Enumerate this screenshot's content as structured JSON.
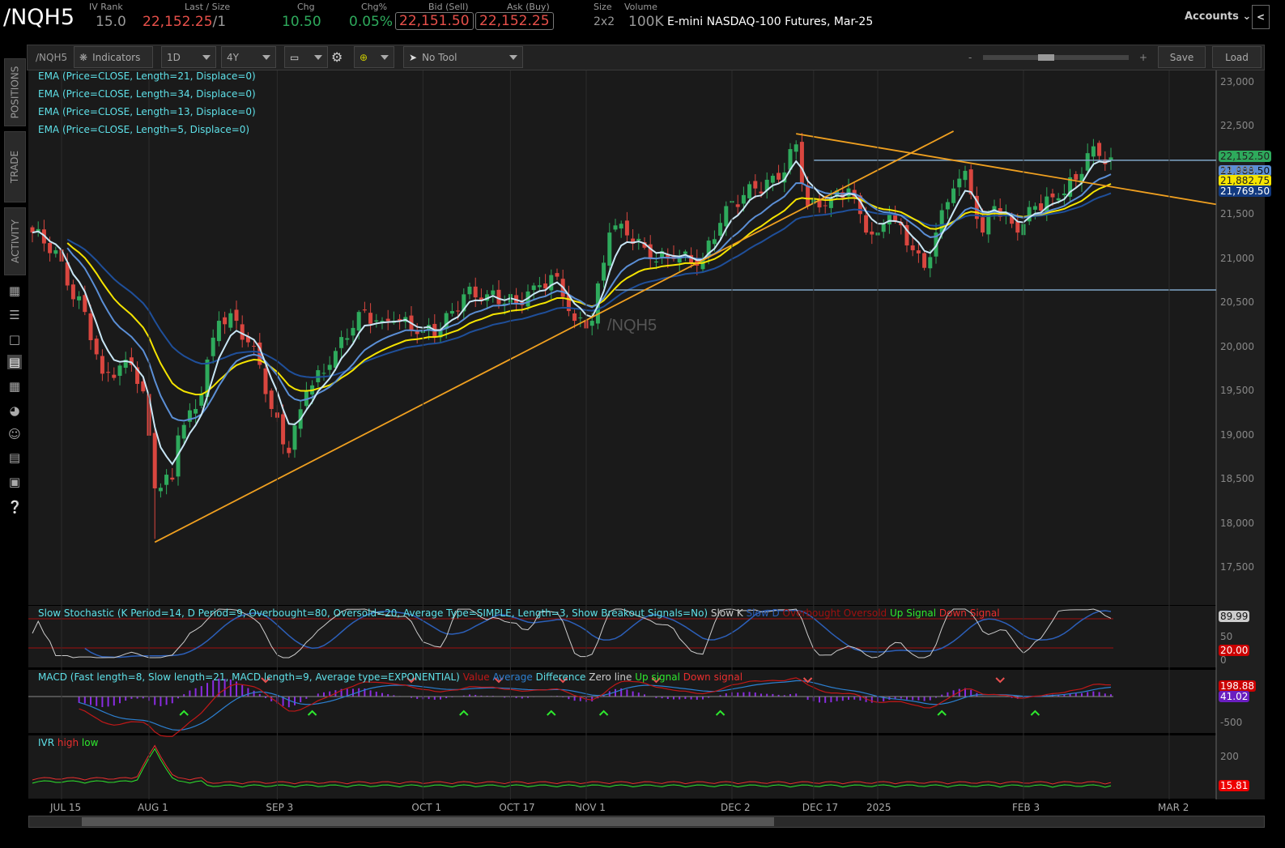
{
  "header": {
    "symbol": "/NQH5",
    "iv_rank_label": "IV Rank",
    "iv_rank": "15.0",
    "last_label": "Last / Size",
    "last": "22,152.25",
    "size_sep": "/1",
    "chg_label": "Chg",
    "chg": "10.50",
    "chgp_label": "Chg%",
    "chgp": "0.05%",
    "bid_label": "Bid (Sell)",
    "bid": "22,151.50",
    "ask_label": "Ask (Buy)",
    "ask": "22,152.25",
    "size_label": "Size",
    "size": "2x2",
    "volume_label": "Volume",
    "volume": "100K",
    "description": "E-mini NASDAQ-100 Futures, Mar-25",
    "accounts": "Accounts",
    "collapse": "<"
  },
  "toolbar": {
    "symbol": "/NQH5",
    "indicators": "Indicators",
    "aggregation": "1D",
    "range": "4Y",
    "tool": "No Tool",
    "zoom_minus": "-",
    "zoom_plus": "+",
    "save": "Save",
    "load": "Load"
  },
  "sidebar": {
    "tabs": [
      "POSITIONS",
      "TRADE",
      "ACTIVITY"
    ]
  },
  "studies": [
    "EMA (Price=CLOSE, Length=21, Displace=0)",
    "EMA (Price=CLOSE, Length=34, Displace=0)",
    "EMA (Price=CLOSE, Length=13, Displace=0)",
    "EMA (Price=CLOSE, Length=5, Displace=0)"
  ],
  "watermark": "/NQH5",
  "stoch": {
    "title": "Slow Stochastic (K Period=14, D Period=9, Overbought=80, Oversold=20, Average Type=SIMPLE, Length=3, Show Breakout Signals=No)",
    "legend": [
      "Slow K",
      "Slow D",
      "Overbought",
      "Oversold",
      "Up Signal",
      "Down Signal"
    ],
    "ticks": [
      "50",
      "0"
    ],
    "tag_k": "89.99",
    "tag_os": "20.00"
  },
  "macd": {
    "title": "MACD (Fast length=8, Slow length=21, MACD length=9, Average type=EXPONENTIAL)",
    "legend": [
      "Value",
      "Average",
      "Difference",
      "Zero line",
      "Up signal",
      "Down signal"
    ],
    "ticks": [
      "-500"
    ],
    "tag_value": "198.88",
    "tag_avg": "41.02"
  },
  "ivr": {
    "title": "IVR",
    "legend": [
      "high",
      "low"
    ],
    "ticks": [
      "200"
    ],
    "tag": "15.81"
  },
  "colors": {
    "up": "#2eaa5c",
    "down": "#d9463f",
    "ema5": "#c8e6f5",
    "ema13": "#5b8fd6",
    "ema21": "#f5e400",
    "ema34": "#1f4f9a",
    "trend": "#f0a020",
    "level": "#7fa6c8"
  },
  "chart_data": {
    "type": "candlestick",
    "title": "/NQH5 1D",
    "ylim": [
      17300,
      23200
    ],
    "yticks": [
      "23,000",
      "22,500",
      "22,000",
      "21,500",
      "21,000",
      "20,500",
      "20,000",
      "19,500",
      "19,000",
      "18,500",
      "18,000",
      "17,500"
    ],
    "ytick_values": [
      23000,
      22500,
      22000,
      21500,
      21000,
      20500,
      20000,
      19500,
      19000,
      18500,
      18000,
      17500
    ],
    "xticks": [
      {
        "day": 5,
        "label": "JUL 15"
      },
      {
        "day": 20,
        "label": "AUG 1"
      },
      {
        "day": 42,
        "label": "SEP 3"
      },
      {
        "day": 67,
        "label": "OCT 1"
      },
      {
        "day": 82,
        "label": "OCT 17"
      },
      {
        "day": 95,
        "label": "NOV 1"
      },
      {
        "day": 120,
        "label": "DEC 2"
      },
      {
        "day": 134,
        "label": "DEC 17"
      },
      {
        "day": 145,
        "label": "2025"
      },
      {
        "day": 170,
        "label": "FEB 3"
      },
      {
        "day": 195,
        "label": "MAR 2"
      }
    ],
    "close_keypoints": [
      [
        0,
        21300
      ],
      [
        4,
        21100
      ],
      [
        6,
        20700
      ],
      [
        9,
        20400
      ],
      [
        12,
        19700
      ],
      [
        17,
        19800
      ],
      [
        19,
        19500
      ],
      [
        21,
        18400
      ],
      [
        24,
        18500
      ],
      [
        25,
        19000
      ],
      [
        28,
        19300
      ],
      [
        32,
        20300
      ],
      [
        35,
        20300
      ],
      [
        39,
        19800
      ],
      [
        41,
        19300
      ],
      [
        44,
        18800
      ],
      [
        47,
        19500
      ],
      [
        51,
        19800
      ],
      [
        56,
        20400
      ],
      [
        60,
        20300
      ],
      [
        62,
        20300
      ],
      [
        67,
        20200
      ],
      [
        70,
        20200
      ],
      [
        74,
        20600
      ],
      [
        78,
        20600
      ],
      [
        83,
        20500
      ],
      [
        86,
        20700
      ],
      [
        90,
        20800
      ],
      [
        93,
        20300
      ],
      [
        96,
        20300
      ],
      [
        99,
        21300
      ],
      [
        101,
        21400
      ],
      [
        106,
        21000
      ],
      [
        110,
        21000
      ],
      [
        115,
        21000
      ],
      [
        119,
        21600
      ],
      [
        124,
        21800
      ],
      [
        128,
        21900
      ],
      [
        131,
        22300
      ],
      [
        133,
        21600
      ],
      [
        136,
        21600
      ],
      [
        140,
        21800
      ],
      [
        143,
        21300
      ],
      [
        145,
        21300
      ],
      [
        147,
        21500
      ],
      [
        151,
        21100
      ],
      [
        153,
        20900
      ],
      [
        155,
        21300
      ],
      [
        158,
        21800
      ],
      [
        160,
        22000
      ],
      [
        163,
        21300
      ],
      [
        165,
        21600
      ],
      [
        169,
        21300
      ],
      [
        172,
        21600
      ],
      [
        175,
        21700
      ],
      [
        179,
        21900
      ],
      [
        181,
        22200
      ],
      [
        185,
        22152
      ]
    ],
    "price_tags": [
      "22,152.50",
      "21,988.50",
      "21,882.75",
      "21,769.50"
    ],
    "horizontal_levels": [
      22120,
      20650
    ],
    "trendlines": [
      [
        [
          21,
          17790
        ],
        [
          158,
          22450
        ]
      ],
      [
        [
          131,
          22420
        ],
        [
          203,
          21620
        ]
      ]
    ],
    "ivr_spike_day": 21
  }
}
